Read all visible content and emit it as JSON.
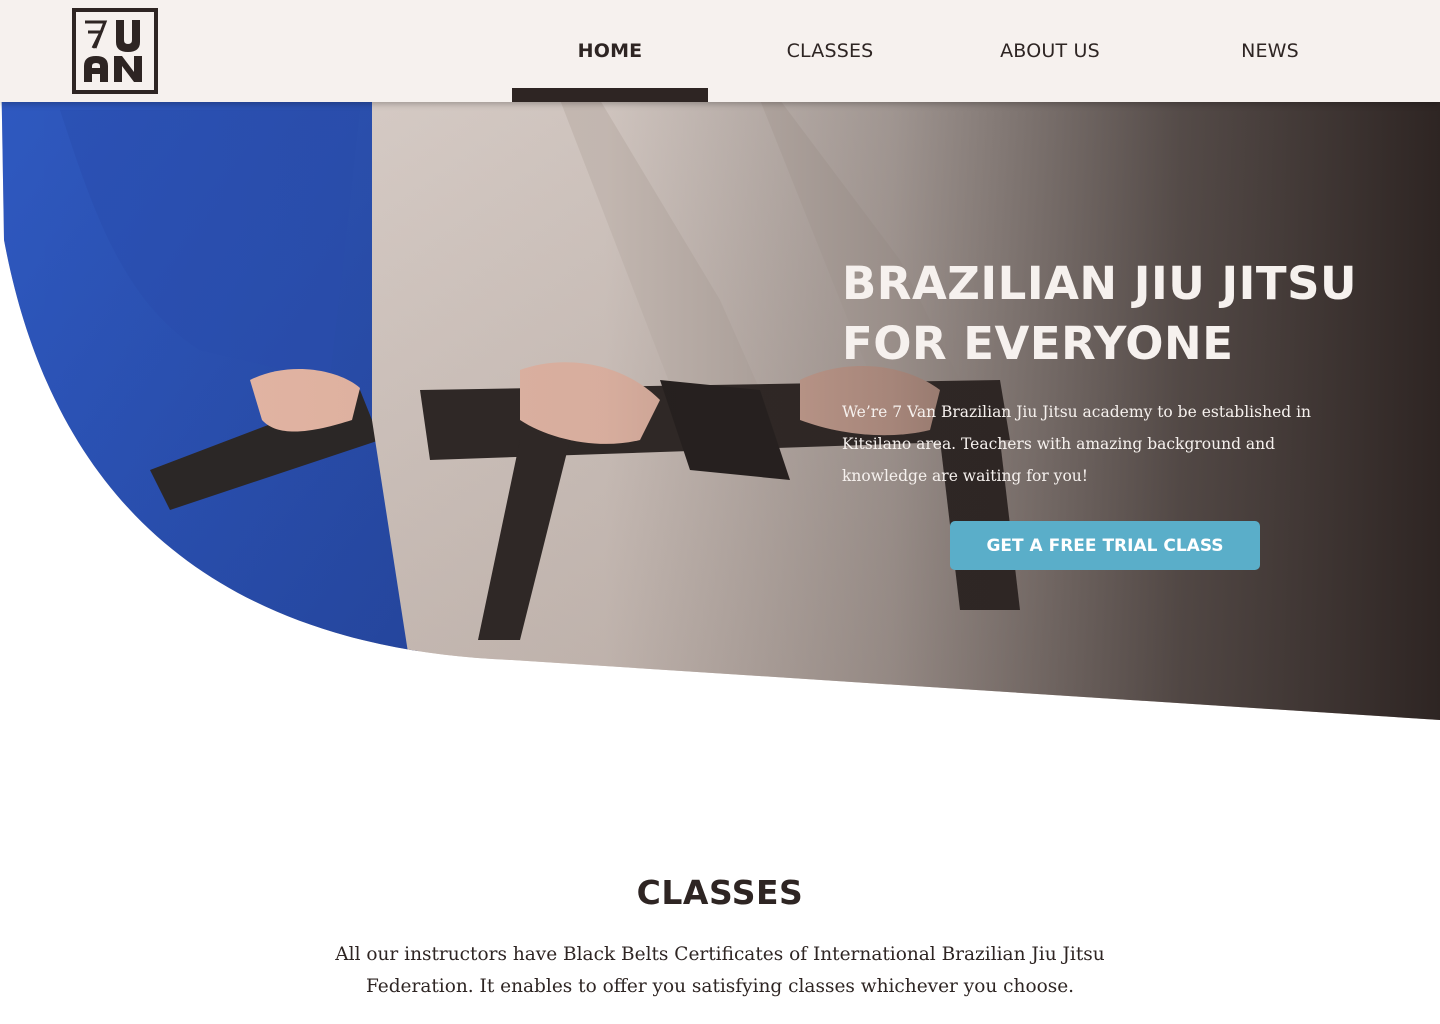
{
  "brand": {
    "logo_text_top": "7U",
    "logo_text_bottom": "AN",
    "logo_icon": "7van-logo-icon"
  },
  "nav": {
    "items": [
      {
        "label": "HOME",
        "active": true
      },
      {
        "label": "CLASSES",
        "active": false
      },
      {
        "label": "ABOUT US",
        "active": false
      },
      {
        "label": "NEWS",
        "active": false
      }
    ]
  },
  "hero": {
    "title_line1": "BRAZILIAN JIU JITSU",
    "title_line2": "FOR EVERYONE",
    "text": "We’re 7 Van Brazilian Jiu Jitsu academy to be established in Kitsilano area. Teachers with amazing background and knowledge are waiting for you!",
    "cta_label": "GET A FREE TRIAL CLASS"
  },
  "classes": {
    "title": "CLASSES",
    "text": "All our instructors have Black Belts Certificates of International Brazilian Jiu Jitsu Federation. It enables to offer you satisfying classes whichever you choose."
  },
  "colors": {
    "dark": "#2e2523",
    "header_bg": "#f6f1ee",
    "accent": "#5aaec9",
    "gi_blue": "#2f55ba",
    "gi_white": "#e4d8d2"
  }
}
